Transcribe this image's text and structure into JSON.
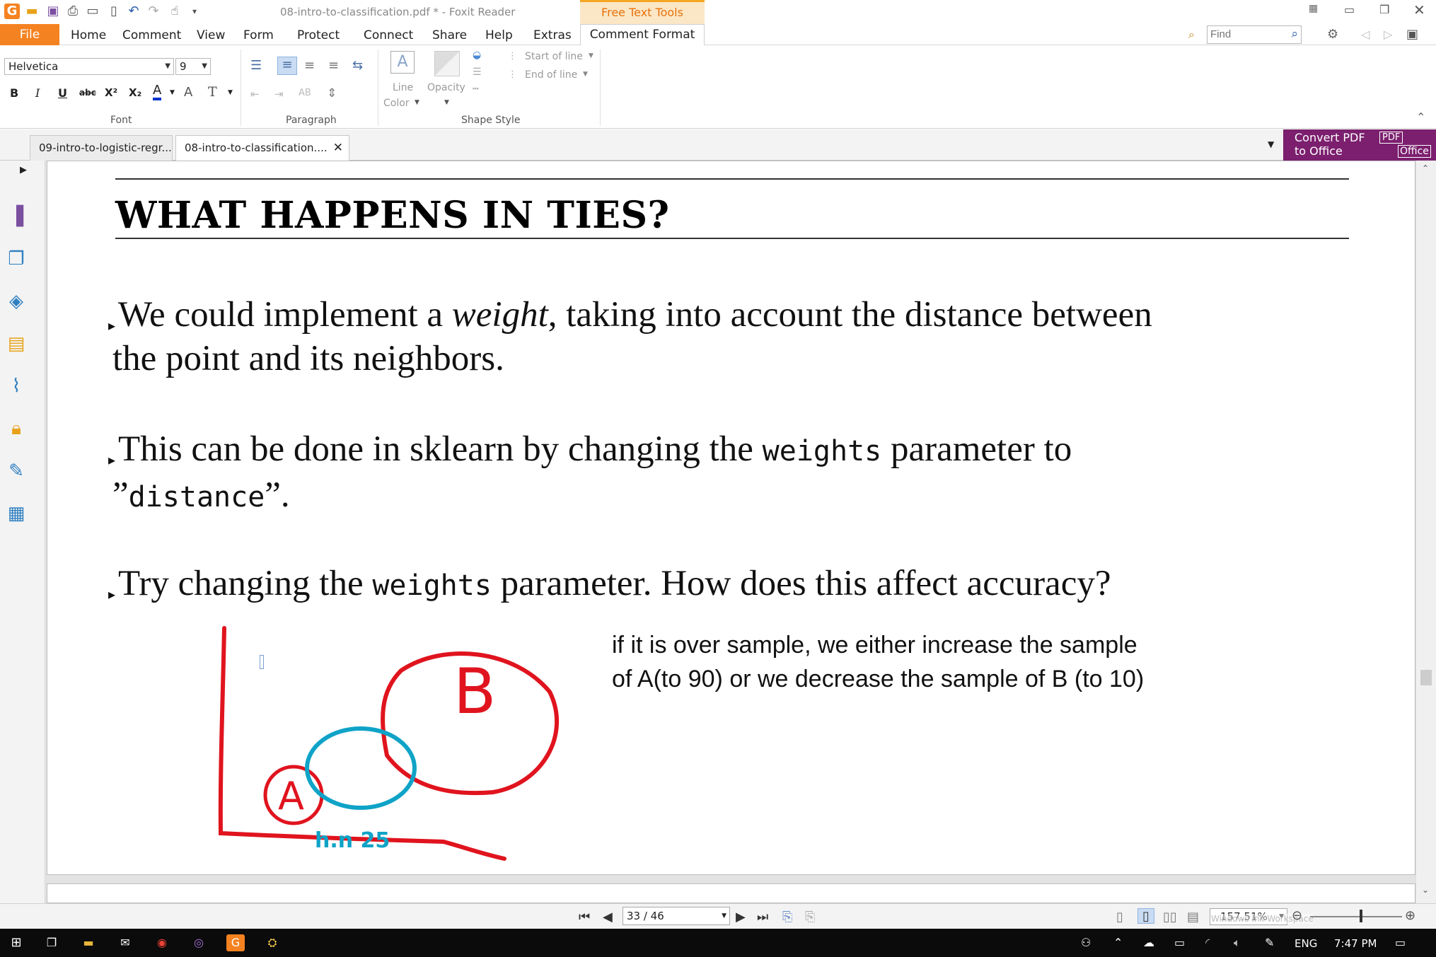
{
  "window": {
    "title": "08-intro-to-classification.pdf * - Foxit Reader",
    "context_tab_header": "Free Text Tools"
  },
  "menu": {
    "file": "File",
    "items": [
      "Home",
      "Comment",
      "View",
      "Form",
      "Protect",
      "Connect",
      "Share",
      "Help",
      "Extras"
    ],
    "context_tab": "Comment Format",
    "find_placeholder": "Find"
  },
  "ribbon": {
    "font_name": "Helvetica",
    "font_size": "9",
    "font_group": "Font",
    "paragraph_group": "Paragraph",
    "shape_style_group": "Shape Style",
    "line_color_1": "Line",
    "line_color_2": "Color",
    "opacity": "Opacity",
    "start_of_line": "Start of line",
    "end_of_line": "End of line",
    "bold": "B",
    "italic": "I",
    "underline": "U",
    "strike": "abc",
    "superscript": "X²",
    "subscript": "X₂",
    "font_color": "A",
    "grow_font": "A",
    "clear_format": "T"
  },
  "tabs": [
    {
      "label": "09-intro-to-logistic-regr..."
    },
    {
      "label": "08-intro-to-classification...."
    }
  ],
  "promo": {
    "line1": "Convert PDF",
    "line2": "to Office",
    "badge1": "PDF",
    "badge2": "Office"
  },
  "slide": {
    "title": "WHAT HAPPENS IN TIES?",
    "b1_pre": "We could implement a ",
    "b1_em": "weight",
    "b1_post": ", taking into account the distance between",
    "b1_line2": "the point and its neighbors.",
    "b2_pre": "This can be done in sklearn by changing the ",
    "b2_code": "weights",
    "b2_post": " parameter to",
    "b2_line2_open": "”",
    "b2_line2_code": "distance",
    "b2_line2_close": "”.",
    "b3_pre": "Try changing the ",
    "b3_code": "weights",
    "b3_post": " parameter.  How does this affect accuracy?",
    "annotation_line1": "if it is over sample, we either increase the sample",
    "annotation_line2": "of A(to 90) or we decrease the sample of B (to 10)",
    "ink_a": "A",
    "ink_b": "B",
    "ink_note": "h.n 25"
  },
  "status": {
    "page": "33 / 46",
    "zoom": "157.51%",
    "watermark": "Windows Ink Workspace"
  },
  "taskbar": {
    "lang": "ENG",
    "time": "7:47 PM"
  },
  "colors": {
    "accent": "#f58220",
    "ink_red": "#e0141e",
    "ink_blue": "#0fa3c7",
    "promo": "#7b1f6e"
  }
}
